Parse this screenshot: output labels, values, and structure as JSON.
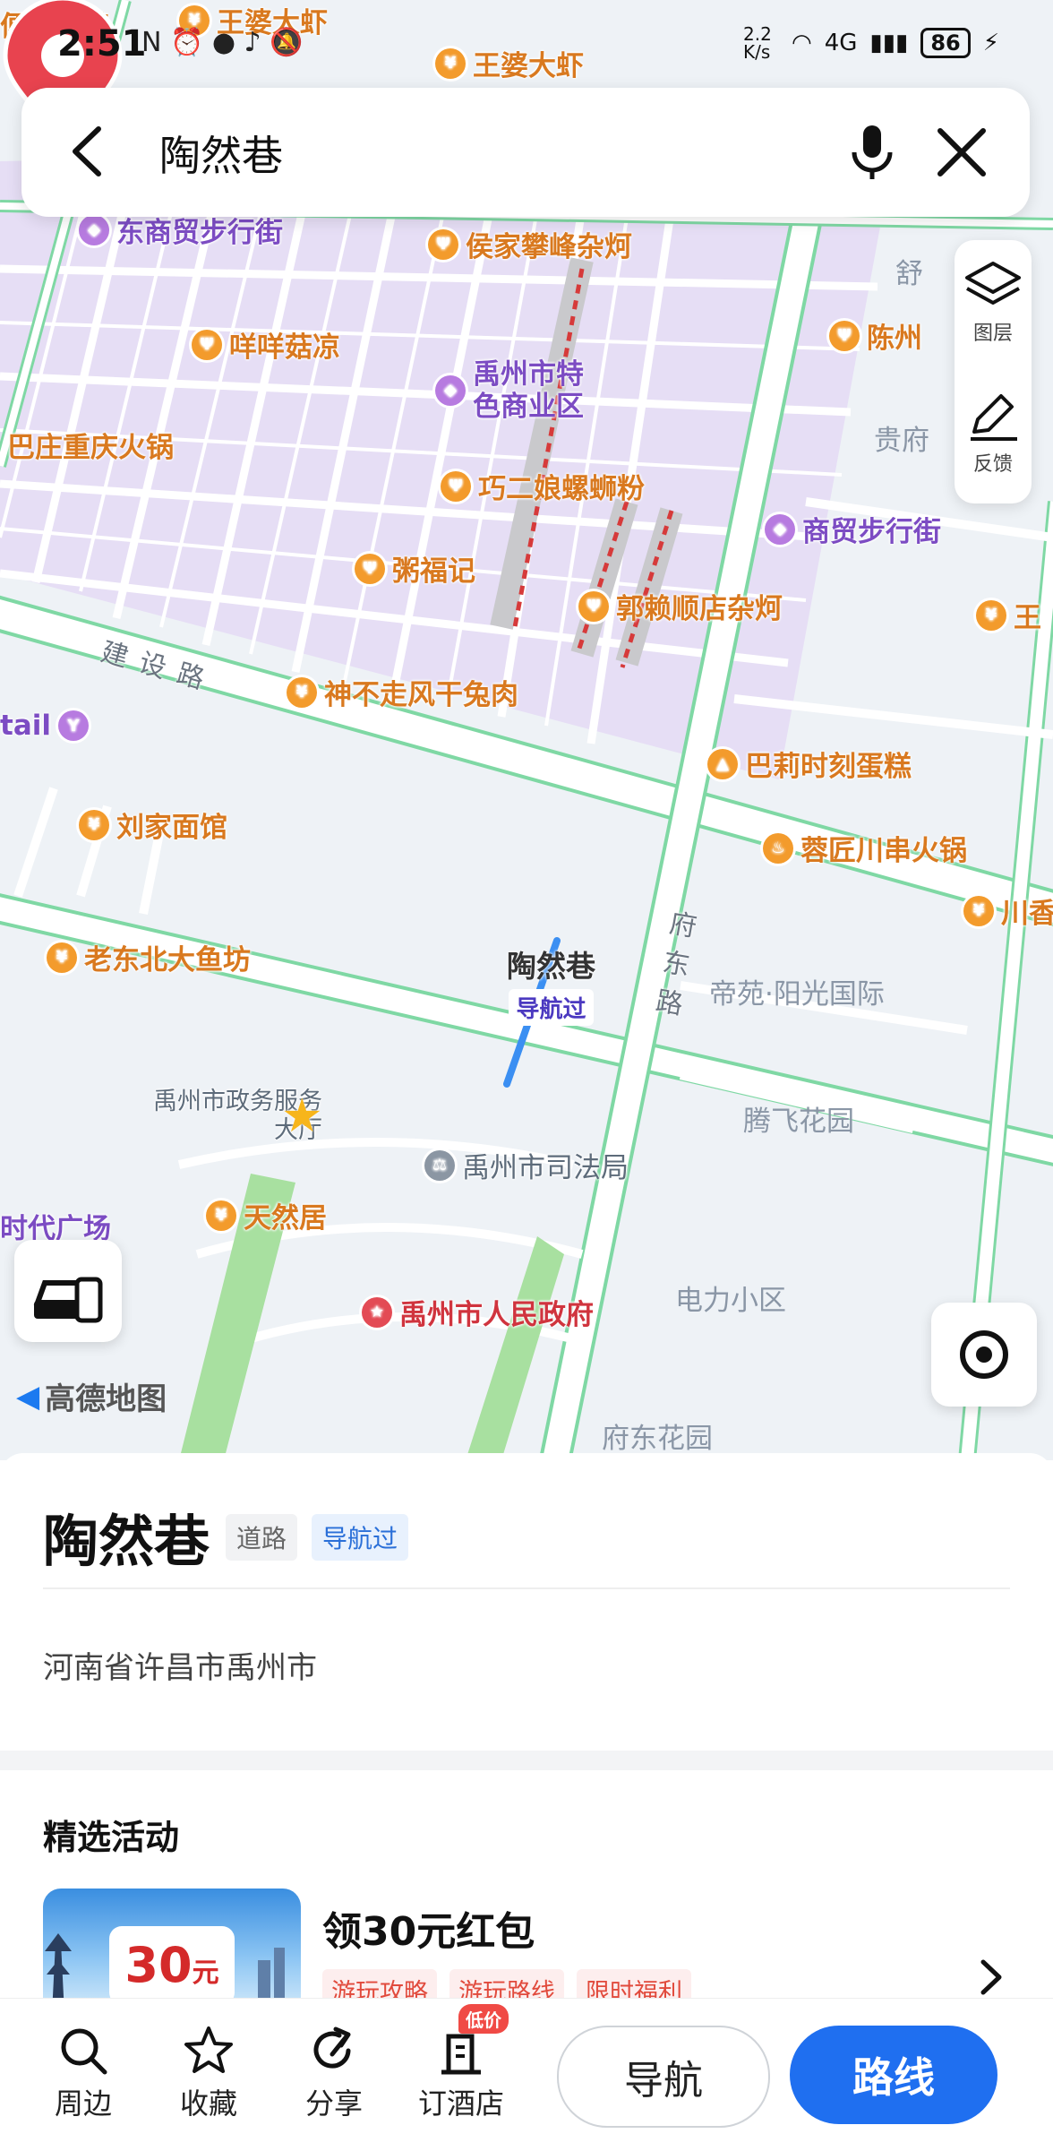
{
  "status_bar": {
    "time": "2:51",
    "net_speed": "2.2 K/s",
    "net_type": "4G",
    "battery": "86"
  },
  "search": {
    "query": "陶然巷"
  },
  "map_tools": {
    "layers_label": "图层",
    "feedback_label": "反馈"
  },
  "map": {
    "pois": [
      "便面炒鸡",
      "王婆大虾",
      "王婆大虾",
      "东商贸步行街",
      "侯家攀峰杂炣",
      "咩咩菇凉",
      "禹州市特色商业区",
      "陈州",
      "巴庄重庆火锅",
      "巧二娘螺蛳粉",
      "商贸步行街",
      "粥福记",
      "郭赖顺店杂炣",
      "王",
      "tail",
      "神不走风干兔肉",
      "巴莉时刻蛋糕",
      "刘家面馆",
      "蓉匠川串火锅",
      "川香",
      "老东北大鱼坊",
      "禹州市政务服务大厅",
      "禹州市司法局",
      "天然居",
      "时代广场",
      "禹州市人民政府"
    ],
    "roads": [
      "建设路",
      "府东路"
    ],
    "areas": [
      "帝苑·阳光国际",
      "腾飞花园",
      "电力小区",
      "府东花园",
      "舒",
      "贵府"
    ],
    "pin_name": "陶然巷",
    "pin_badge": "导航过",
    "brand": "高德地图"
  },
  "place": {
    "name": "陶然巷",
    "type_tag": "道路",
    "visited_tag": "导航过",
    "address": "河南省许昌市禹州市"
  },
  "activity": {
    "heading": "精选活动",
    "thumb_badge": "30",
    "thumb_badge_unit": "元",
    "title": "领30元红包",
    "chips": [
      "游玩攻略",
      "游玩路线",
      "限时福利"
    ]
  },
  "bottom_bar": {
    "nearby": "周边",
    "favorite": "收藏",
    "share": "分享",
    "hotel": "订酒店",
    "hotel_badge": "低价",
    "navigate": "导航",
    "route": "路线"
  },
  "colors": {
    "accent_blue": "#1f6ff0",
    "pin_red": "#e8434f",
    "poi_orange": "#f39b2c",
    "commercial_area": "#e4dcf4"
  }
}
